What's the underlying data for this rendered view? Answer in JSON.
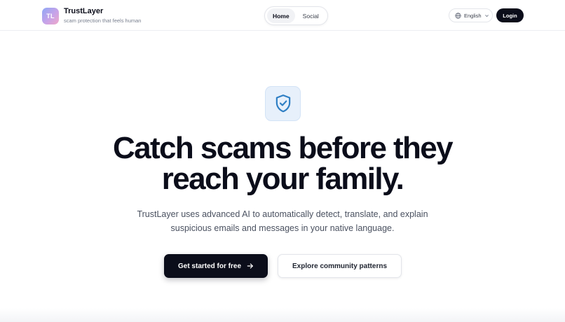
{
  "brand": {
    "logo_initials": "TL",
    "name": "TrustLayer",
    "tagline": "scam protection that feels human"
  },
  "nav": {
    "tabs": [
      {
        "label": "Home",
        "active": true
      },
      {
        "label": "Social",
        "active": false
      }
    ]
  },
  "header": {
    "language": "English",
    "language_icon": "globe-icon",
    "login_label": "Login"
  },
  "hero": {
    "icon": "shield-check-icon",
    "headline_line1": "Catch scams before they",
    "headline_line2": "reach your family.",
    "subtext_line1": "TrustLayer uses advanced AI to automatically detect, translate, and explain",
    "subtext_line2": "suspicious emails and messages in your native language.",
    "primary_cta": "Get started for free",
    "primary_cta_icon": "arrow-right-icon",
    "secondary_cta": "Explore community patterns"
  },
  "colors": {
    "primary": "#0b0d1a",
    "shield_accent": "#2f7fc4",
    "shield_bg": "#e7f0fb"
  }
}
